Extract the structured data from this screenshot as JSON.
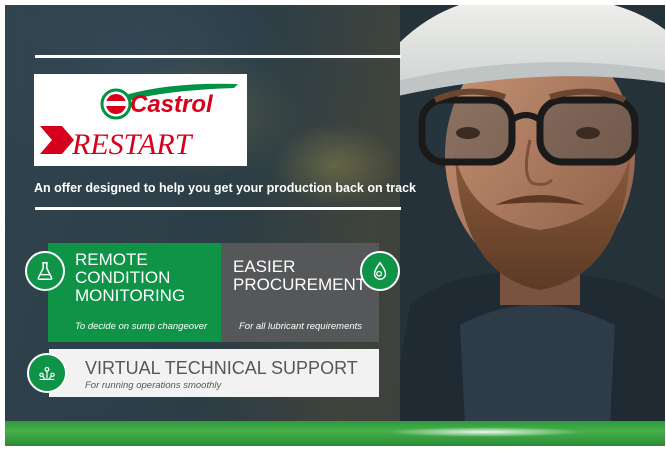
{
  "brand": {
    "castrol": "Castrol",
    "restart": "RESTART",
    "colors": {
      "red": "#d6001c",
      "green": "#009343",
      "white": "#ffffff"
    }
  },
  "tagline": "An offer designed to help you get your production back on track",
  "tiles": [
    {
      "id": "remote",
      "title_lines": [
        "REMOTE",
        "CONDITION",
        "MONITORING"
      ],
      "subtitle": "To decide on sump changeover",
      "icon": "flask-icon",
      "color": "#0e9347"
    },
    {
      "id": "procurement",
      "title_lines": [
        "EASIER",
        "PROCUREMENT"
      ],
      "subtitle": "For all lubricant requirements",
      "icon": "oil-drop-gear-icon",
      "color": "#555759"
    },
    {
      "id": "support",
      "title": "VIRTUAL TECHNICAL SUPPORT",
      "subtitle": "For running operations smoothly",
      "icon": "support-network-icon",
      "color": "#f2f2f2"
    }
  ],
  "background": {
    "subject": "engineer-with-hard-hat-and-glasses"
  }
}
